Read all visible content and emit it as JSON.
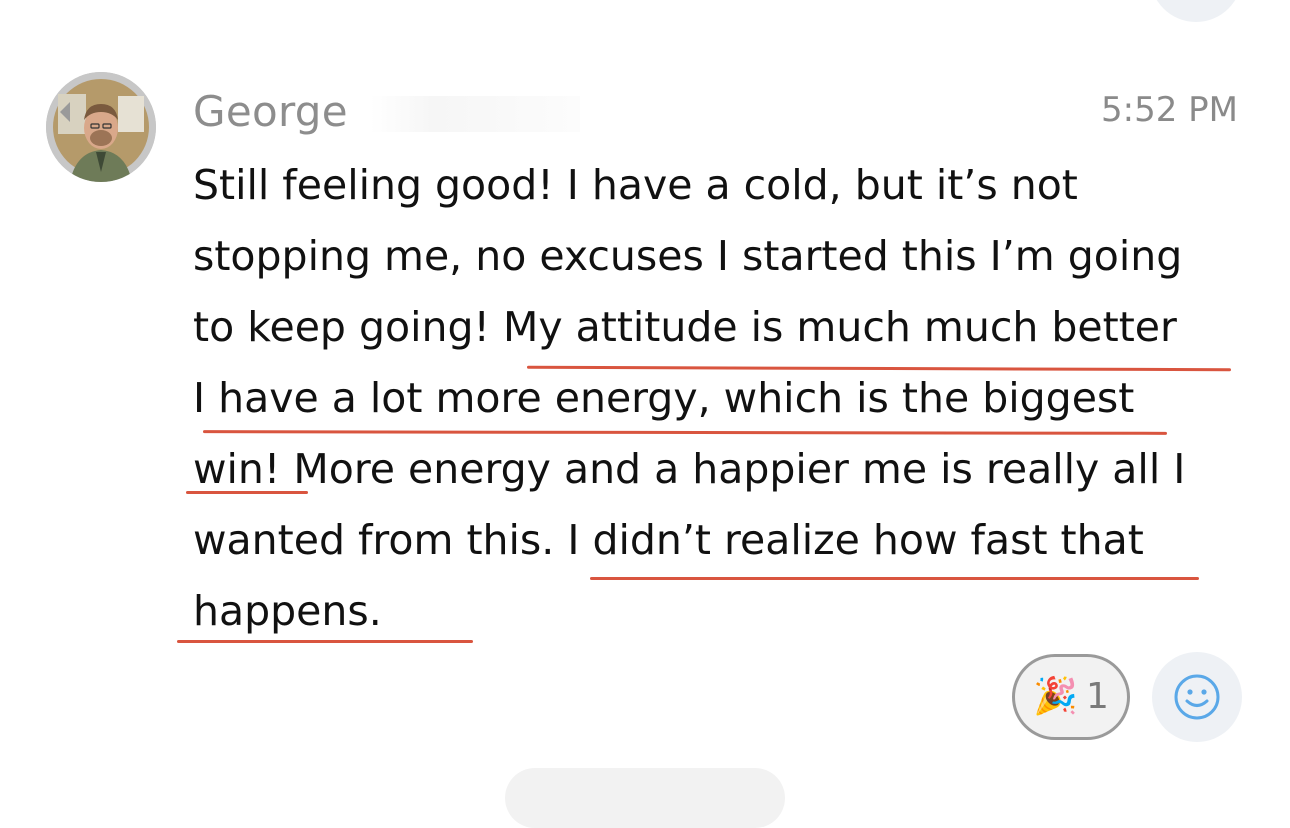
{
  "message": {
    "sender_name": "George",
    "timestamp": "5:52 PM",
    "text_lines": [
      "Still feeling good! I have a cold, but it’s not",
      "stopping me, no excuses I started this I’m going",
      "to keep going! My attitude is much much better",
      "I have a lot more energy, which is the biggest",
      "win! More energy and a happier me is really all I",
      "wanted from this. I didn’t realize how fast that",
      "happens."
    ]
  },
  "reactions": [
    {
      "emoji": "🎉",
      "count": "1"
    }
  ],
  "icons": {
    "avatar": "user-avatar-photo",
    "add_reaction": "smiley-face-icon"
  },
  "colors": {
    "underline": "#d9553f",
    "add_reaction_icon": "#5aa8e8",
    "sender_name": "#8d8d8d"
  }
}
